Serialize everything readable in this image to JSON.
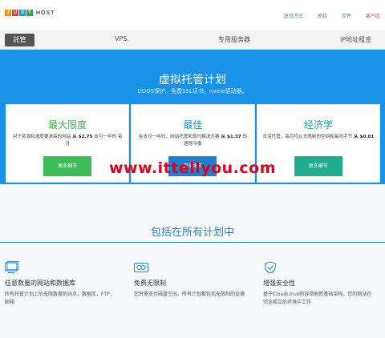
{
  "logo": {
    "letters": [
      "J",
      "U",
      "S",
      "T"
    ],
    "letter_colors": [
      "#f39200",
      "#e8412c",
      "#1a9ad6",
      "#2aa44f"
    ],
    "wordmark": "HOST"
  },
  "top_links": [
    {
      "label": "支付方式",
      "highlight": false
    },
    {
      "label": "支持",
      "highlight": false
    },
    {
      "label": "文件",
      "highlight": false
    },
    {
      "label": "客户区",
      "highlight": true
    }
  ],
  "nav": {
    "active": "託管",
    "items": [
      "VPS.",
      "专用服务器",
      "IP地址租金"
    ]
  },
  "hero": {
    "title": "虚拟托管计划",
    "subtitle": "DDOS保护。免费SSL证书。nvme驱动器。"
  },
  "plans": [
    {
      "title": "最大限度",
      "desc_prefix": "对于资源和速度要求高的网站 ",
      "desc_bold": "从 $2.75",
      "desc_suffix": " 支付一年时 每月",
      "button": "更多细节",
      "color": "green"
    },
    {
      "title": "最佳",
      "desc_prefix": "在支付一年时，网站托管和现代解决方案 ",
      "desc_bold": "从 $1.37",
      "desc_suffix": " 的 理想平衡",
      "button": "更多细节",
      "color": "blue"
    },
    {
      "title": "经济学",
      "desc_prefix": "灵活托管，每月均以无限制的空间和每兆字节 ",
      "desc_bold": "从 $0.01",
      "desc_suffix": "",
      "button": "更多细节",
      "color": "teal"
    }
  ],
  "watermark": "www.ittellyou.com",
  "features": {
    "title": "包括在所有计划中",
    "items": [
      {
        "icon": "monitor-icon",
        "title": "任意数量的网站和数据库",
        "desc": "所有托管计划上的无限数量的站点，数据库，FTP，邮箱"
      },
      {
        "icon": "infinity-icon",
        "title": "免费无限制",
        "desc": "您只需支付磁盘空间。所有计划都包括无限制的交通"
      },
      {
        "icon": "shield-icon",
        "title": "增强安全性",
        "desc": "基于CloudLinux的容错刷新基础架构。您的网站在完全孤立的环境中工作"
      }
    ]
  }
}
